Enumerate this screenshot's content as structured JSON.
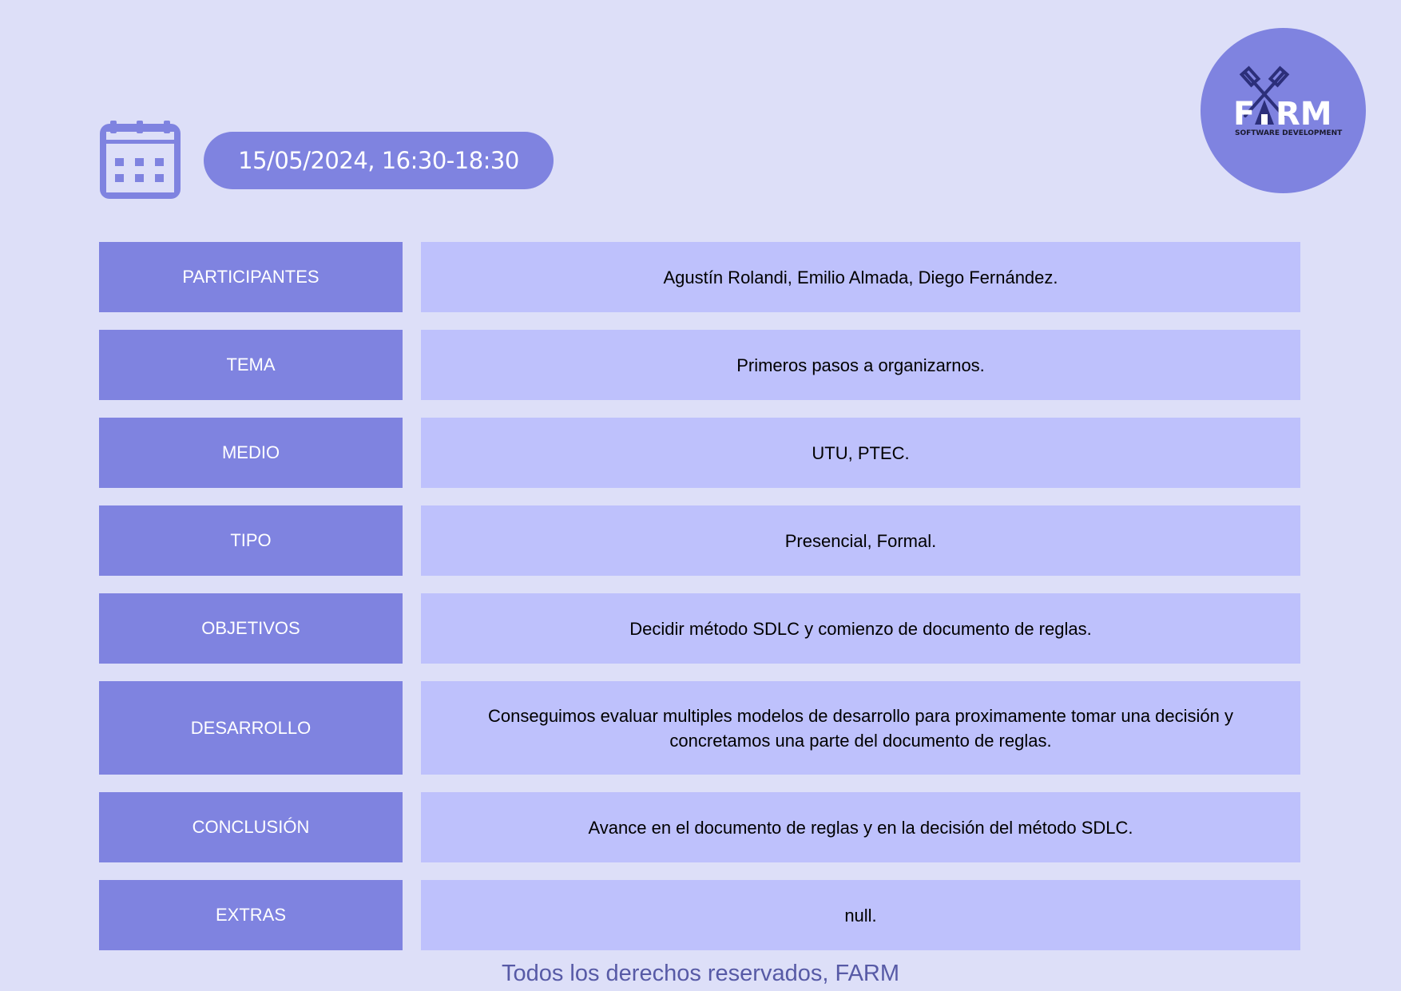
{
  "header": {
    "date_time": "15/05/2024, 16:30-18:30",
    "calendar_icon": "calendar-icon"
  },
  "logo": {
    "brand": "FARM",
    "tagline": "SOFTWARE DEVELOPMENT",
    "icon": "windmill-icon"
  },
  "rows": [
    {
      "label": "PARTICIPANTES",
      "value": "Agustín Rolandi, Emilio Almada, Diego Fernández."
    },
    {
      "label": "TEMA",
      "value": "Primeros pasos a organizarnos."
    },
    {
      "label": "MEDIO",
      "value": "UTU, PTEC."
    },
    {
      "label": "TIPO",
      "value": "Presencial, Formal."
    },
    {
      "label": "OBJETIVOS",
      "value": "Decidir método SDLC y comienzo de documento de reglas."
    },
    {
      "label": "DESARROLLO",
      "value": "Conseguimos evaluar multiples modelos de desarrollo para proximamente tomar una decisión y concretamos una parte del documento de reglas."
    },
    {
      "label": "CONCLUSIÓN",
      "value": "Avance en el documento de reglas y en la decisión del método SDLC."
    },
    {
      "label": "EXTRAS",
      "value": "null."
    }
  ],
  "footer": {
    "text": "Todos los derechos reservados, FARM"
  },
  "colors": {
    "background": "#dddff8",
    "accent": "#7f83e0",
    "value_fill": "#bec1fc",
    "footer_text": "#575aa6"
  }
}
